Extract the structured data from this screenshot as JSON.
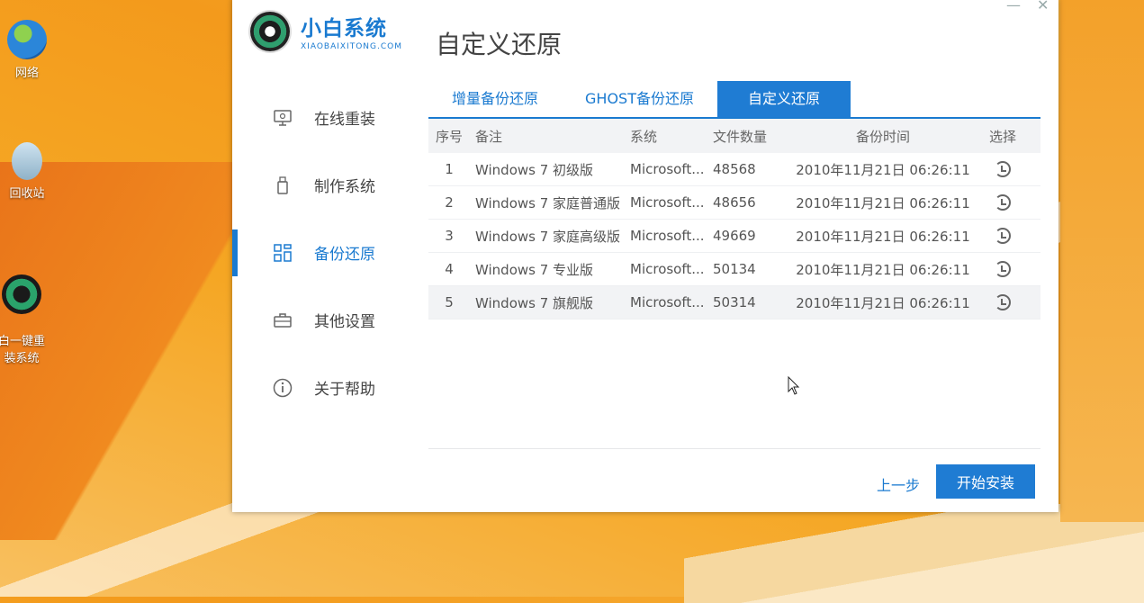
{
  "desktop": {
    "icons": [
      {
        "label": "网络",
        "icon": "network-globe-icon"
      },
      {
        "label": "回收站",
        "icon": "recycle-bin-icon"
      },
      {
        "label": "白一键重\n装系统",
        "icon": "xiaobai-app-icon"
      }
    ]
  },
  "window": {
    "brand": {
      "name": "小白系统",
      "subtitle": "XIAOBAIXITONG.COM"
    },
    "controls": {
      "minimize": "—",
      "close": "✕"
    },
    "nav": [
      {
        "label": "在线重装",
        "icon": "monitor-icon",
        "active": false
      },
      {
        "label": "制作系统",
        "icon": "usb-drive-icon",
        "active": false
      },
      {
        "label": "备份还原",
        "icon": "grid-icon",
        "active": true
      },
      {
        "label": "其他设置",
        "icon": "briefcase-icon",
        "active": false
      },
      {
        "label": "关于帮助",
        "icon": "info-icon",
        "active": false
      }
    ],
    "page_title": "自定义还原",
    "tabs": [
      {
        "label": "增量备份还原",
        "active": false
      },
      {
        "label": "GHOST备份还原",
        "active": false
      },
      {
        "label": "自定义还原",
        "active": true
      }
    ],
    "table": {
      "headers": [
        "序号",
        "备注",
        "系统",
        "文件数量",
        "备份时间",
        "选择"
      ],
      "rows": [
        {
          "no": "1",
          "note": "Windows 7 初级版",
          "system": "Microsoft...",
          "count": "48568",
          "time": "2010年11月21日 06:26:11"
        },
        {
          "no": "2",
          "note": "Windows 7 家庭普通版",
          "system": "Microsoft...",
          "count": "48656",
          "time": "2010年11月21日 06:26:11"
        },
        {
          "no": "3",
          "note": "Windows 7 家庭高级版",
          "system": "Microsoft...",
          "count": "49669",
          "time": "2010年11月21日 06:26:11"
        },
        {
          "no": "4",
          "note": "Windows 7 专业版",
          "system": "Microsoft...",
          "count": "50134",
          "time": "2010年11月21日 06:26:11"
        },
        {
          "no": "5",
          "note": "Windows 7 旗舰版",
          "system": "Microsoft...",
          "count": "50314",
          "time": "2010年11月21日 06:26:11"
        }
      ]
    },
    "footer": {
      "prev_label": "上一步",
      "install_label": "开始安装"
    },
    "colors": {
      "accent": "#1f7cd3"
    }
  }
}
